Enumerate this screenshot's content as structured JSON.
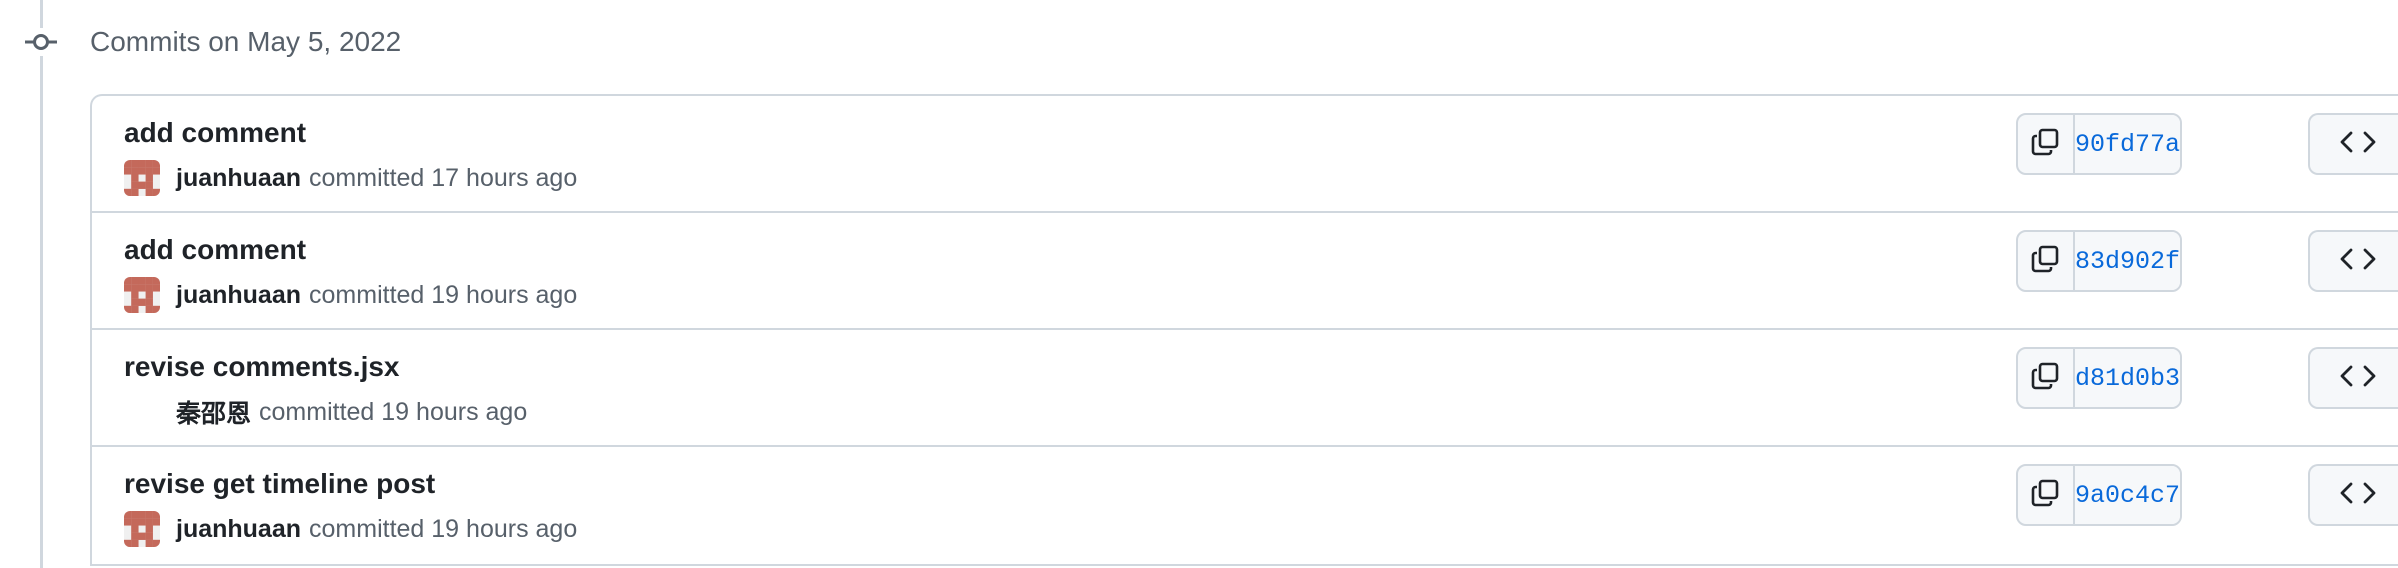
{
  "group": {
    "heading": "Commits on May 5, 2022"
  },
  "commits": [
    {
      "title": "add comment",
      "author": "juanhuaan",
      "has_avatar": true,
      "action": "committed",
      "time": "17 hours ago",
      "sha": "90fd77a"
    },
    {
      "title": "add comment",
      "author": "juanhuaan",
      "has_avatar": true,
      "action": "committed",
      "time": "19 hours ago",
      "sha": "83d902f"
    },
    {
      "title": "revise comments.jsx",
      "author": "秦邵恩",
      "has_avatar": false,
      "action": "committed",
      "time": "19 hours ago",
      "sha": "d81d0b3"
    },
    {
      "title": "revise get timeline post",
      "author": "juanhuaan",
      "has_avatar": true,
      "action": "committed",
      "time": "19 hours ago",
      "sha": "9a0c4c7"
    }
  ],
  "icons": {
    "timeline_node": "git-commit-icon",
    "copy": "copy-icon",
    "browse": "code-icon",
    "avatar": "identicon"
  },
  "colors": {
    "sha_link": "#0969da",
    "avatar": "#c4695b",
    "border": "#d0d7de",
    "muted_text": "#57606a"
  }
}
